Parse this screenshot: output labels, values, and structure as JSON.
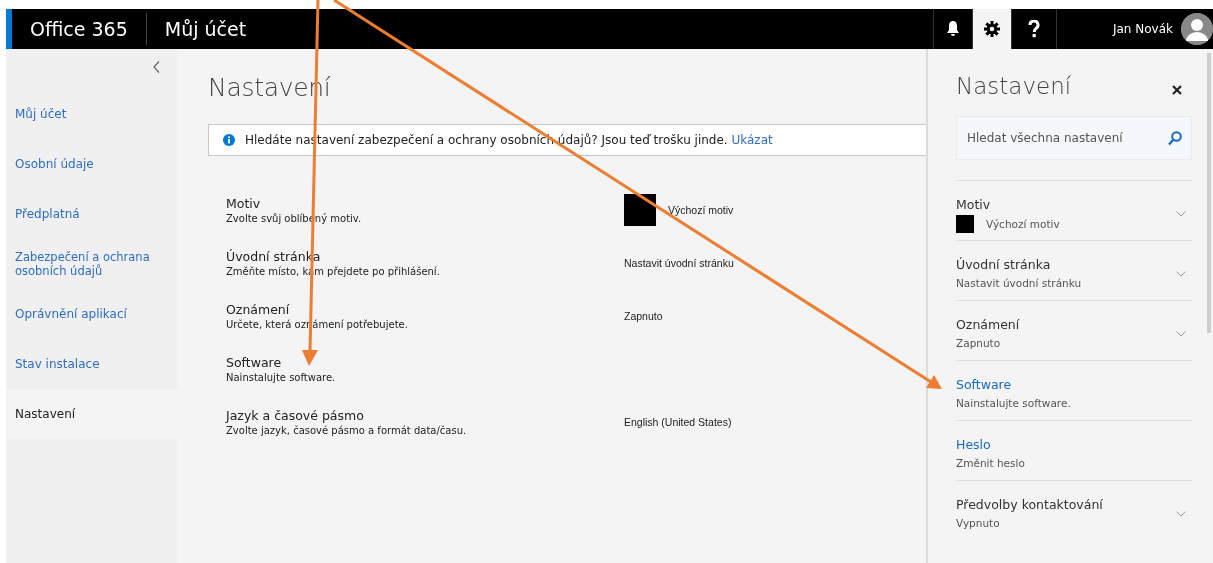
{
  "header": {
    "app_title": "Office 365",
    "page_title": "Můj účet",
    "icons": [
      {
        "kind": "bell",
        "selected": false
      },
      {
        "kind": "gear",
        "selected": true
      },
      {
        "kind": "help",
        "selected": false
      }
    ],
    "user_name": "Jan Novák"
  },
  "sidebar": {
    "items": [
      {
        "label": "Můj účet",
        "selected": false
      },
      {
        "label": "Osobní údaje",
        "selected": false
      },
      {
        "label": "Předplatná",
        "selected": false
      },
      {
        "label": "Zabezpečení a ochrana osobních údajů",
        "selected": false
      },
      {
        "label": "Oprávnění aplikací",
        "selected": false
      },
      {
        "label": "Stav instalace",
        "selected": false
      },
      {
        "label": "Nastavení",
        "selected": true
      }
    ]
  },
  "main": {
    "title": "Nastavení",
    "notice": {
      "text": "Hledáte nastavení zabezpečení a ochrany osobních údajů? Jsou teď trošku jinde.",
      "link": "Ukázat"
    },
    "settings": [
      {
        "kind": "theme",
        "title": "Motiv",
        "description": "Zvolte svůj oblíbený motiv.",
        "value": "Výchozí motiv"
      },
      {
        "kind": "text",
        "title": "Úvodní stránka",
        "description": "Změňte místo, kam přejdete po přihlášení.",
        "value": "Nastavit úvodní stránku"
      },
      {
        "kind": "text",
        "title": "Oznámení",
        "description": "Určete, která oznámení potřebujete.",
        "value": "Zapnuto"
      },
      {
        "kind": "none",
        "title": "Software",
        "description": "Nainstalujte software."
      },
      {
        "kind": "text",
        "title": "Jazyk a časové pásmo",
        "description": "Zvolte jazyk, časové pásmo a formát data/času.",
        "value": "English (United States)"
      }
    ]
  },
  "panel": {
    "title": "Nastavení",
    "search": {
      "placeholder": "Hledat všechna nastavení"
    },
    "items": [
      {
        "kind": "theme",
        "title": "Motiv",
        "value": "Výchozí motiv"
      },
      {
        "kind": "dropdown",
        "title": "Úvodní stránka",
        "value": "Nastavit úvodní stránku"
      },
      {
        "kind": "dropdown",
        "title": "Oznámení",
        "value": "Zapnuto"
      },
      {
        "kind": "link",
        "title": "Software",
        "value": "Nainstalujte software."
      },
      {
        "kind": "link",
        "title": "Heslo",
        "value": "Změnit heslo"
      },
      {
        "kind": "dropdown",
        "title": "Předvolby kontaktování",
        "value": "Vypnuto"
      }
    ]
  }
}
